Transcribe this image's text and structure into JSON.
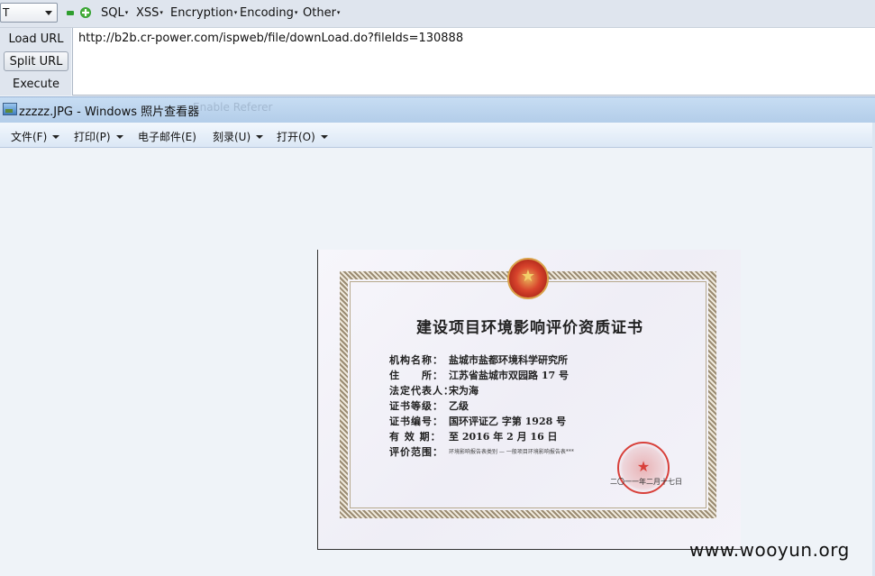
{
  "hackbar": {
    "method_value": "T",
    "menus": [
      "SQL",
      "XSS",
      "Encryption",
      "Encoding",
      "Other"
    ],
    "buttons": {
      "load": "Load URL",
      "split": "Split URL",
      "execute": "Execute"
    },
    "url": "http://b2b.cr-power.com/ispweb/file/downLoad.do?fileIds=130888"
  },
  "viewer": {
    "title": "zzzzz.JPG - Windows 照片查看器",
    "ghost_text": "Enable Referer",
    "menus": [
      "文件(F)",
      "打印(P)",
      "电子邮件(E)",
      "刻录(U)",
      "打开(O)"
    ]
  },
  "certificate": {
    "title": "建设项目环境影响评价资质证书",
    "fields": [
      {
        "label": "机构名称：",
        "value": "盐城市盐都环境科学研究所"
      },
      {
        "label": "住　　所：",
        "value": "江苏省盐城市双园路 17 号"
      },
      {
        "label": "法定代表人：",
        "value": "宋为海"
      },
      {
        "label": "证书等级：",
        "value": "乙级"
      },
      {
        "label": "证书编号：",
        "value": "国环评证乙  字第   1928      号"
      },
      {
        "label": "有 效 期：",
        "value": "至 2016 年 2 月 16 日"
      },
      {
        "label": "评价范围：",
        "value": "环境影响报告表类别 — 一般项目环境影响报告表***"
      }
    ],
    "issue_date": "二〇一一年二月十七日"
  },
  "watermark": "www.wooyun.org"
}
